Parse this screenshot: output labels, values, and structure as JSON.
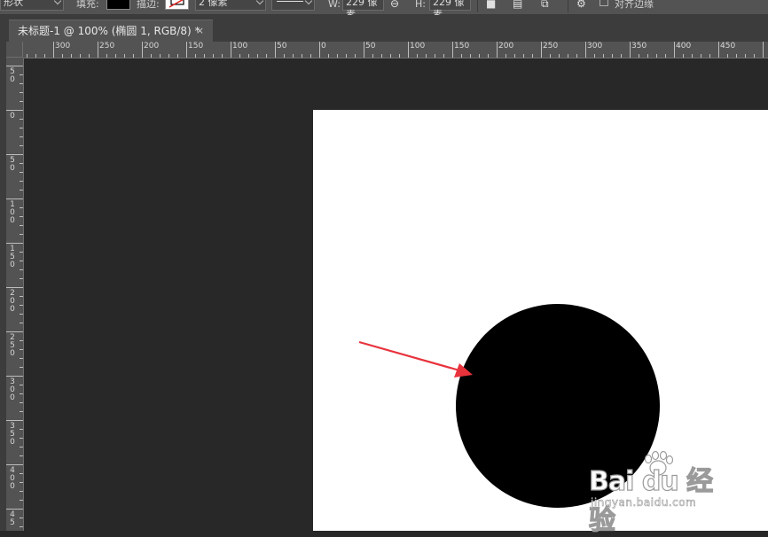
{
  "options_bar": {
    "tool_mode": "形状",
    "fill_label": "填充:",
    "stroke_label": "描边:",
    "stroke_width": "2 像素",
    "width_label": "W:",
    "width_value": "229 像素",
    "height_label": "H:",
    "height_value": "229 像素",
    "align_edges_label": "对齐边缘"
  },
  "document_tab": {
    "title": "未标题-1 @ 100% (椭圆 1, RGB/8) *",
    "close_glyph": "×"
  },
  "ruler_horizontal": [
    "300",
    "250",
    "200",
    "150",
    "100",
    "50",
    "0",
    "50",
    "100",
    "150",
    "200",
    "250",
    "300",
    "350",
    "400",
    "450"
  ],
  "ruler_vertical": [
    "5\n0",
    "0",
    "5\n0",
    "1\n0\n0",
    "1\n5\n0",
    "2\n0\n0",
    "2\n5\n0",
    "3\n0\n0",
    "3\n5\n0",
    "4\n0\n0",
    "4\n5"
  ],
  "watermark": {
    "brand": "Bai du 经验",
    "site": "jingyan.baidu.com"
  },
  "colors": {
    "ui_bg": "#535353",
    "pasteboard": "#282828",
    "canvas": "#ffffff",
    "shape_fill": "#000000",
    "annotation_arrow": "#e8323c"
  }
}
